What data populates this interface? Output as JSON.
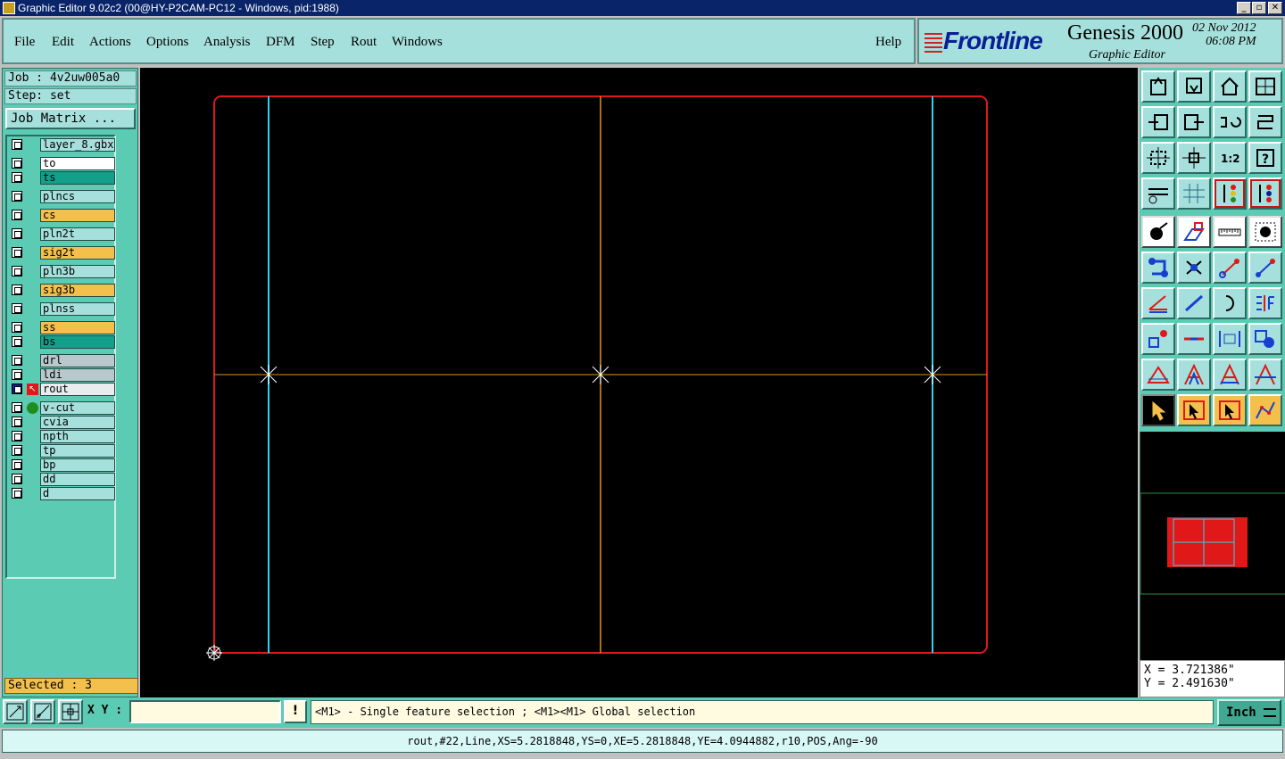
{
  "window": {
    "title": "Graphic Editor 9.02c2 (00@HY-P2CAM-PC12 - Windows, pid:1988)"
  },
  "menu": {
    "file": "File",
    "edit": "Edit",
    "actions": "Actions",
    "options": "Options",
    "analysis": "Analysis",
    "dfm": "DFM",
    "step": "Step",
    "rout": "Rout",
    "windows": "Windows",
    "help": "Help"
  },
  "logo": {
    "brand": "Frontline",
    "product": "Genesis 2000",
    "subtitle": "Graphic Editor",
    "date": "02 Nov 2012",
    "time": "06:08 PM"
  },
  "job": {
    "job_label": "Job : 4v2uw005a0",
    "step_label": "Step: set",
    "matrix_button": "Job Matrix ..."
  },
  "layers": [
    {
      "name": "layer_8.gbx",
      "color": "#a6e0dc"
    },
    {
      "name": "to",
      "color": "#ffffff"
    },
    {
      "name": "ts",
      "color": "#12a08a"
    },
    {
      "name": "plncs",
      "color": "#a6e0dc"
    },
    {
      "name": "cs",
      "color": "#f3c04c"
    },
    {
      "name": "pln2t",
      "color": "#a6e0dc"
    },
    {
      "name": "sig2t",
      "color": "#f3c04c"
    },
    {
      "name": "pln3b",
      "color": "#a6e0dc"
    },
    {
      "name": "sig3b",
      "color": "#f3c04c"
    },
    {
      "name": "plnss",
      "color": "#a6e0dc"
    },
    {
      "name": "ss",
      "color": "#f3c04c"
    },
    {
      "name": "bs",
      "color": "#12a08a"
    },
    {
      "name": "drl",
      "color": "#b8c8cc"
    },
    {
      "name": "ldi",
      "color": "#b8c8cc"
    },
    {
      "name": "rout",
      "color": "#e8ecee"
    },
    {
      "name": "v-cut",
      "color": "#a6e0dc"
    },
    {
      "name": "cvia",
      "color": "#a6e0dc"
    },
    {
      "name": "npth",
      "color": "#a6e0dc"
    },
    {
      "name": "tp",
      "color": "#a6e0dc"
    },
    {
      "name": "bp",
      "color": "#a6e0dc"
    },
    {
      "name": "dd",
      "color": "#a6e0dc"
    },
    {
      "name": "d",
      "color": "#a6e0dc"
    }
  ],
  "selected": "Selected : 3",
  "coords": {
    "x": "X = 3.721386\"",
    "y": "Y = 2.491630\""
  },
  "bottom": {
    "xy_label": "X Y :",
    "xy_value": "",
    "bang": "!",
    "hint": "<M1> - Single feature selection ; <M1><M1> Global selection",
    "units": "Inch"
  },
  "status": "rout,#22,Line,XS=5.2818848,YS=0,XE=5.2818848,YE=4.0944882,r10,POS,Ang=-90",
  "colors": {
    "canvas": "#000000",
    "outline": "#e01818",
    "route_cyan": "#2ad4f0",
    "vcut_orange": "#e0941c",
    "panel_teal": "#5ccbb3",
    "panel_light": "#a6e0dc"
  }
}
